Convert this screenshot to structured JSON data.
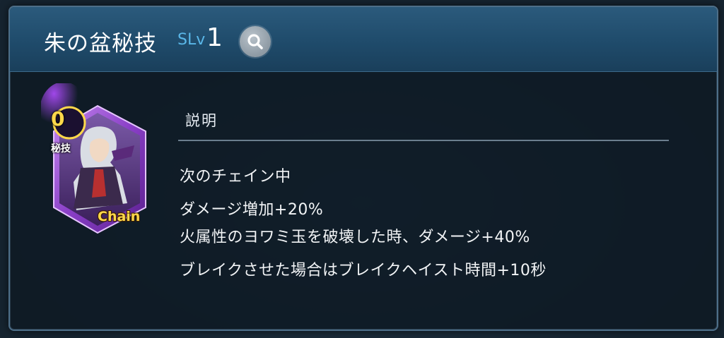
{
  "skill": {
    "name": "朱の盆秘技",
    "level_prefix": "SLv",
    "level_value": "1"
  },
  "section": {
    "title": "説明"
  },
  "description": {
    "lines": [
      "次のチェイン中",
      "ダメージ増加+20%",
      "火属性のヨワミ玉を破壊した時、ダメージ+40%",
      "ブレイクさせた場合はブレイクヘイスト時間+10秒"
    ]
  },
  "card": {
    "badge_value": "0",
    "badge_label": "秘技",
    "chain_label": "Chain"
  },
  "icons": {
    "search": "magnifier-icon",
    "card": "character-card-icon"
  },
  "colors": {
    "header_blue": "#1f4b6b",
    "level_blue": "#5ab7e8",
    "card_purple": "#8a3fc7",
    "chain_yellow": "#ffd84a"
  }
}
